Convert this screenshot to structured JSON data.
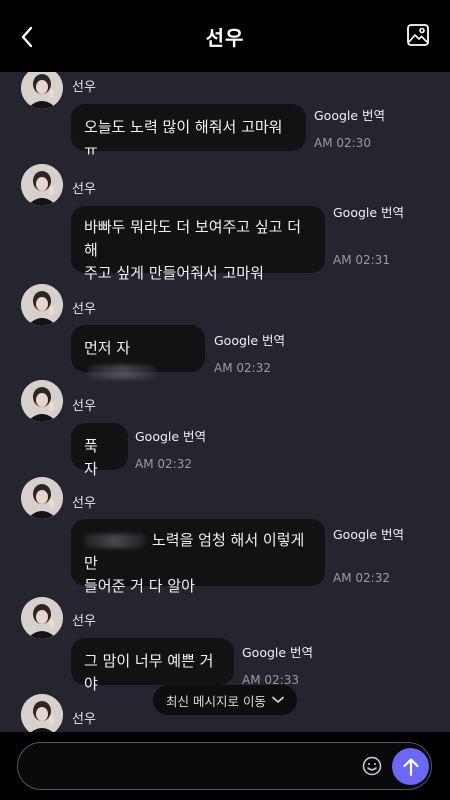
{
  "header": {
    "title": "선우"
  },
  "translate_label": "Google 번역",
  "messages": [
    {
      "sender": "선우",
      "text": "오늘도 노력 많이 해줘서 고마워 ㅠ",
      "time": "AM 02:30"
    },
    {
      "sender": "선우",
      "lines": [
        "바빠두 뭐라도 더 보여주고 싶고 더 해",
        "주고 싶게 만들어줘서 고마워"
      ],
      "time": "AM 02:31"
    },
    {
      "sender": "선우",
      "text": "먼저 자",
      "time": "AM 02:32"
    },
    {
      "sender": "선우",
      "text": "푹 자",
      "time": "AM 02:32"
    },
    {
      "sender": "선우",
      "lines": [
        "노력을 엄청 해서 이렇게 만",
        "들어준 거 다 알아"
      ],
      "time": "AM 02:32"
    },
    {
      "sender": "선우",
      "text": "그 맘이 너무 예쁜 거야",
      "time": "AM 02:33"
    },
    {
      "sender": "선우"
    }
  ],
  "latest_button": {
    "label": "최신 메시지로 이동"
  },
  "composer": {
    "placeholder": ""
  },
  "colors": {
    "accent": "#6b68f5",
    "background": "#24252f",
    "bubble": "#121214"
  }
}
